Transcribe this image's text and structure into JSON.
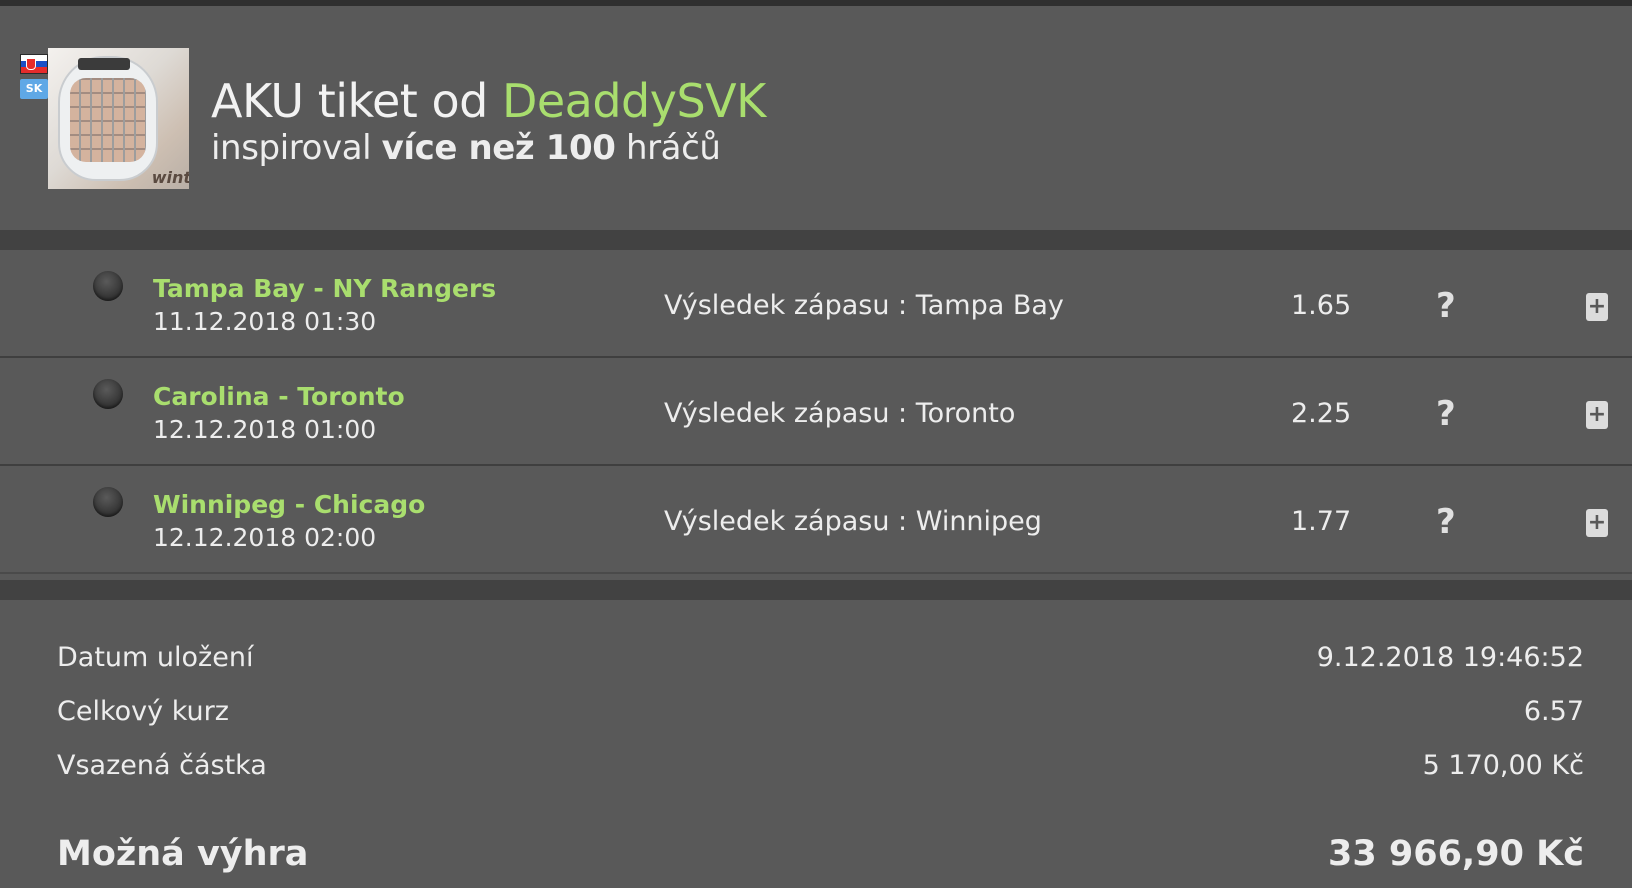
{
  "header": {
    "title_prefix": "AKU tiket od ",
    "username": "DeaddySVK",
    "subtitle_prefix": "inspiroval ",
    "subtitle_bold": "více než 100",
    "subtitle_suffix": " hráčů",
    "lang_badge": "SK",
    "avatar_brand": "wint",
    "accent_color": "#a9de6e"
  },
  "bets": [
    {
      "match": "Tampa Bay - NY Rangers",
      "date": "11.12.2018 01:30",
      "pick": "Výsledek zápasu : Tampa Bay",
      "odds": "1.65",
      "status": "?"
    },
    {
      "match": "Carolina - Toronto",
      "date": "12.12.2018 01:00",
      "pick": "Výsledek zápasu : Toronto",
      "odds": "2.25",
      "status": "?"
    },
    {
      "match": "Winnipeg - Chicago",
      "date": "12.12.2018 02:00",
      "pick": "Výsledek zápasu : Winnipeg",
      "odds": "1.77",
      "status": "?"
    }
  ],
  "summary": {
    "saved_label": "Datum uložení",
    "saved_value": "9.12.2018 19:46:52",
    "total_odds_label": "Celkový kurz",
    "total_odds_value": "6.57",
    "stake_label": "Vsazená částka",
    "stake_value": "5 170,00 Kč",
    "win_label": "Možná výhra",
    "win_value": "33 966,90 Kč"
  }
}
